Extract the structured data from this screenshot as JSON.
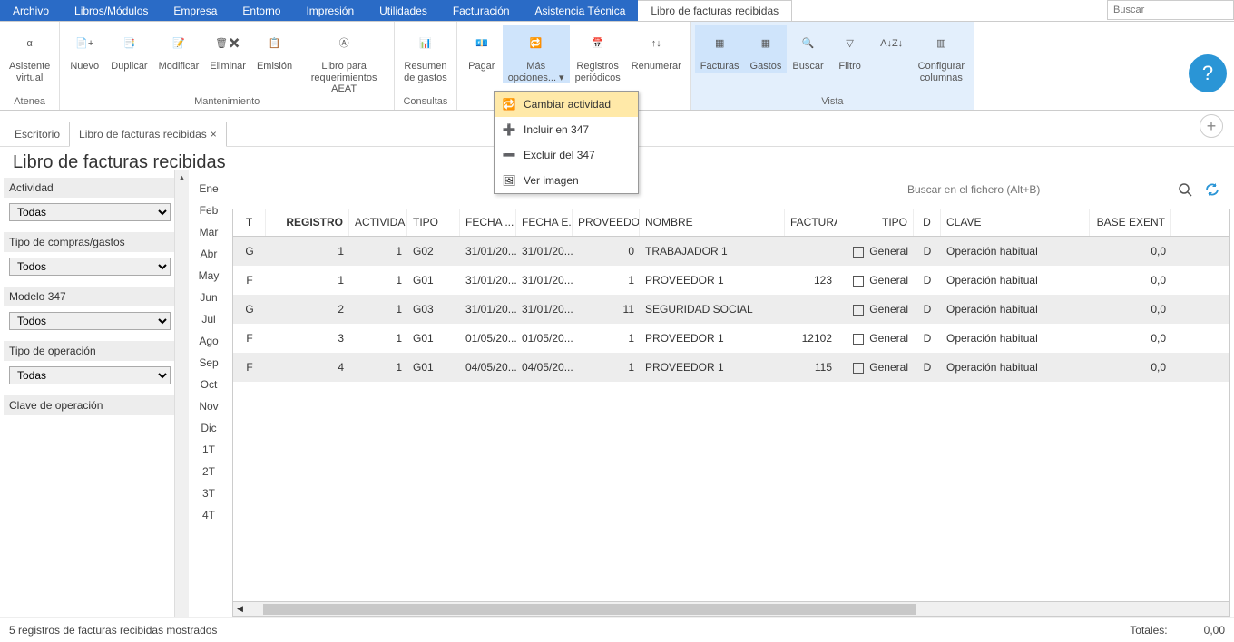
{
  "menu": [
    "Archivo",
    "Libros/Módulos",
    "Empresa",
    "Entorno",
    "Impresión",
    "Utilidades",
    "Facturación",
    "Asistencia Técnica"
  ],
  "active_tab": "Libro de facturas recibidas",
  "search_placeholder": "Buscar",
  "ribbon": {
    "groups": [
      {
        "label": "Atenea",
        "buttons": [
          {
            "label": "Asistente\nvirtual",
            "icon": "α",
            "name": "asistente-virtual"
          }
        ]
      },
      {
        "label": "Mantenimiento",
        "buttons": [
          {
            "label": "Nuevo",
            "icon": "📄+",
            "name": "nuevo-button"
          },
          {
            "label": "Duplicar",
            "icon": "📑",
            "name": "duplicar-button"
          },
          {
            "label": "Modificar",
            "icon": "📝",
            "name": "modificar-button"
          },
          {
            "label": "Eliminar",
            "icon": "🗑✖",
            "name": "eliminar-button"
          },
          {
            "label": "Emisión",
            "icon": "📋",
            "name": "emision-button"
          },
          {
            "label": "Libro para\nrequerimientos AEAT",
            "icon": "Ⓐ",
            "name": "libro-aeat-button"
          }
        ]
      },
      {
        "label": "Consultas",
        "buttons": [
          {
            "label": "Resumen\nde gastos",
            "icon": "📊",
            "name": "resumen-gastos-button"
          }
        ]
      },
      {
        "label": "",
        "buttons": [
          {
            "label": "Pagar",
            "icon": "💶",
            "name": "pagar-button"
          },
          {
            "label": "Más\nopciones... ▾",
            "icon": "🔁",
            "name": "mas-opciones-button",
            "highlight": true
          },
          {
            "label": "Registros\nperiódicos",
            "icon": "📅",
            "name": "registros-periodicos-button"
          },
          {
            "label": "Renumerar",
            "icon": "↑↓",
            "name": "renumerar-button"
          }
        ]
      },
      {
        "label": "Vista",
        "highlight_bg": true,
        "buttons": [
          {
            "label": "Facturas",
            "icon": "▦",
            "name": "facturas-toggle",
            "highlight": true
          },
          {
            "label": "Gastos",
            "icon": "▦",
            "name": "gastos-toggle",
            "highlight": true
          },
          {
            "label": "Buscar",
            "icon": "🔍",
            "name": "buscar-button"
          },
          {
            "label": "Filtro",
            "icon": "▽",
            "name": "filtro-button"
          },
          {
            "label": "",
            "icon": "A↓Z↓",
            "name": "sort-button"
          },
          {
            "label": "Configurar\ncolumnas",
            "icon": "▥",
            "name": "config-columnas-button"
          }
        ]
      }
    ]
  },
  "dropdown": [
    {
      "label": "Cambiar actividad",
      "icon": "🔁"
    },
    {
      "label": "Incluir en 347",
      "icon": "➕"
    },
    {
      "label": "Excluir del 347",
      "icon": "➖"
    },
    {
      "label": "Ver imagen",
      "icon": "🖼"
    }
  ],
  "workspace_tabs": [
    {
      "label": "Escritorio",
      "active": false
    },
    {
      "label": "Libro de facturas recibidas",
      "active": true,
      "closable": true
    }
  ],
  "page_title": "Libro de facturas recibidas",
  "sidebar_filters": [
    {
      "label": "Actividad",
      "value": "Todas"
    },
    {
      "label": "Tipo de compras/gastos",
      "value": "Todos"
    },
    {
      "label": "Modelo 347",
      "value": "Todos"
    },
    {
      "label": "Tipo de operación",
      "value": "Todas"
    },
    {
      "label": "Clave de operación",
      "value": ""
    }
  ],
  "months": [
    "Ene",
    "Feb",
    "Mar",
    "Abr",
    "May",
    "Jun",
    "Jul",
    "Ago",
    "Sep",
    "Oct",
    "Nov",
    "Dic",
    "1T",
    "2T",
    "3T",
    "4T"
  ],
  "grid_search_placeholder": "Buscar en el fichero (Alt+B)",
  "grid_columns": [
    "T",
    "REGISTRO",
    "ACTIVIDAD",
    "TIPO",
    "FECHA ...",
    "FECHA E...",
    "PROVEEDOR",
    "NOMBRE",
    "FACTURA",
    "TIPO",
    "D",
    "CLAVE",
    "BASE EXENT"
  ],
  "grid_rows": [
    {
      "t": "G",
      "reg": "1",
      "act": "1",
      "tipo": "G02",
      "f1": "31/01/20...",
      "f2": "31/01/20...",
      "prov": "0",
      "nombre": "TRABAJADOR 1",
      "fact": "",
      "tipo2": "General",
      "d": "D",
      "clave": "Operación habitual",
      "base": "0,0"
    },
    {
      "t": "F",
      "reg": "1",
      "act": "1",
      "tipo": "G01",
      "f1": "31/01/20...",
      "f2": "31/01/20...",
      "prov": "1",
      "nombre": "PROVEEDOR 1",
      "fact": "123",
      "tipo2": "General",
      "d": "D",
      "clave": "Operación habitual",
      "base": "0,0"
    },
    {
      "t": "G",
      "reg": "2",
      "act": "1",
      "tipo": "G03",
      "f1": "31/01/20...",
      "f2": "31/01/20...",
      "prov": "11",
      "nombre": "SEGURIDAD SOCIAL",
      "fact": "",
      "tipo2": "General",
      "d": "D",
      "clave": "Operación habitual",
      "base": "0,0"
    },
    {
      "t": "F",
      "reg": "3",
      "act": "1",
      "tipo": "G01",
      "f1": "01/05/20...",
      "f2": "01/05/20...",
      "prov": "1",
      "nombre": "PROVEEDOR 1",
      "fact": "12102",
      "tipo2": "General",
      "d": "D",
      "clave": "Operación habitual",
      "base": "0,0"
    },
    {
      "t": "F",
      "reg": "4",
      "act": "1",
      "tipo": "G01",
      "f1": "04/05/20...",
      "f2": "04/05/20...",
      "prov": "1",
      "nombre": "PROVEEDOR 1",
      "fact": "115",
      "tipo2": "General",
      "d": "D",
      "clave": "Operación habitual",
      "base": "0,0"
    }
  ],
  "footer_status": "5 registros de facturas recibidas mostrados",
  "totals_label": "Totales:",
  "totals_value": "0,00"
}
